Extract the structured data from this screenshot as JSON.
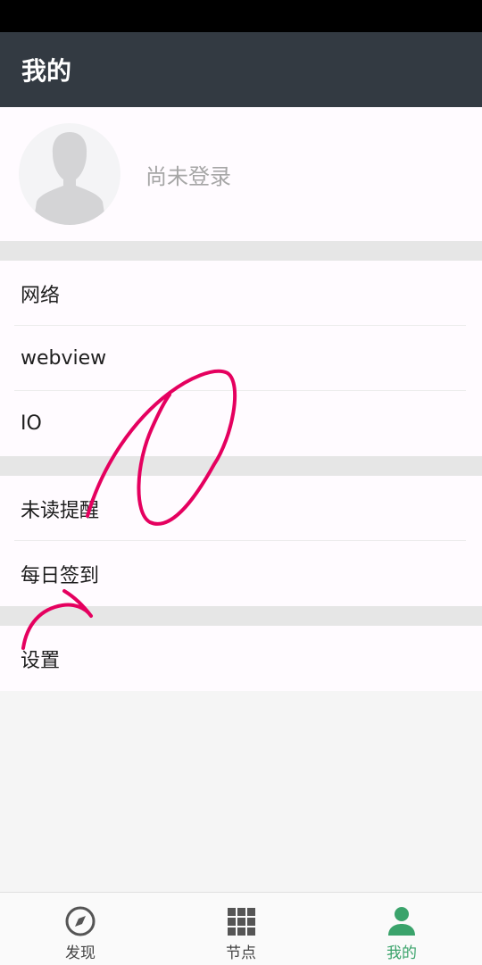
{
  "header": {
    "title": "我的"
  },
  "profile": {
    "login_status": "尚未登录"
  },
  "groups": {
    "network": [
      "网络",
      "webview",
      "IO"
    ],
    "reminders": [
      "未读提醒",
      "每日签到"
    ],
    "settings": [
      "设置"
    ]
  },
  "bottom_nav": {
    "discover": "发现",
    "nodes": "节点",
    "mine": "我的"
  },
  "colors": {
    "app_bar": "#333a42",
    "active_tab": "#3aa36b",
    "annotation": "#e5005f"
  },
  "icons": {
    "avatar": "person-silhouette-icon",
    "discover": "compass-icon",
    "nodes": "grid-icon",
    "mine": "person-icon"
  }
}
